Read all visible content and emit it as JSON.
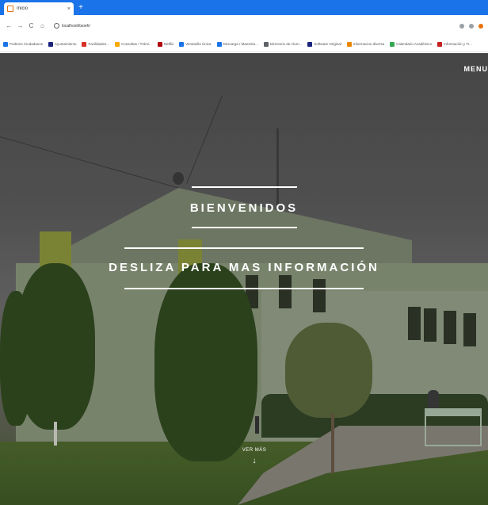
{
  "browser": {
    "tab_title": "Inicio",
    "tab_close": "×",
    "new_tab": "+",
    "url": "localhost/itsoeh/",
    "nav": {
      "back": "←",
      "forward": "→",
      "reload": "C",
      "home": "⌂"
    },
    "bookmarks": [
      {
        "label": "Poderes Ciudadanos",
        "color": "#1a73e8"
      },
      {
        "label": "Ayuntamiento",
        "color": "#1a237e"
      },
      {
        "label": "Facilidades...",
        "color": "#d93025"
      },
      {
        "label": "Consultas / Trámi...",
        "color": "#f9ab00"
      },
      {
        "label": "Netflix",
        "color": "#b00710"
      },
      {
        "label": "Ventanilla Única",
        "color": "#1a73e8"
      },
      {
        "label": "Descarga / Maestría...",
        "color": "#1a73e8"
      },
      {
        "label": "Directorio de Alum...",
        "color": "#5f6368"
      },
      {
        "label": "Software Original",
        "color": "#1a237e"
      },
      {
        "label": "Informacion diversa",
        "color": "#ea8600"
      },
      {
        "label": "Calendario Académico",
        "color": "#34a853"
      },
      {
        "label": "Información y Tr...",
        "color": "#c5221f"
      }
    ]
  },
  "page": {
    "menu_label": "MENU",
    "welcome_heading": "BIENVENIDOS",
    "scroll_heading": "DESLIZA PARA MAS INFORMACIÓN",
    "more_label": "VER MÁS",
    "more_arrow": "↓"
  }
}
